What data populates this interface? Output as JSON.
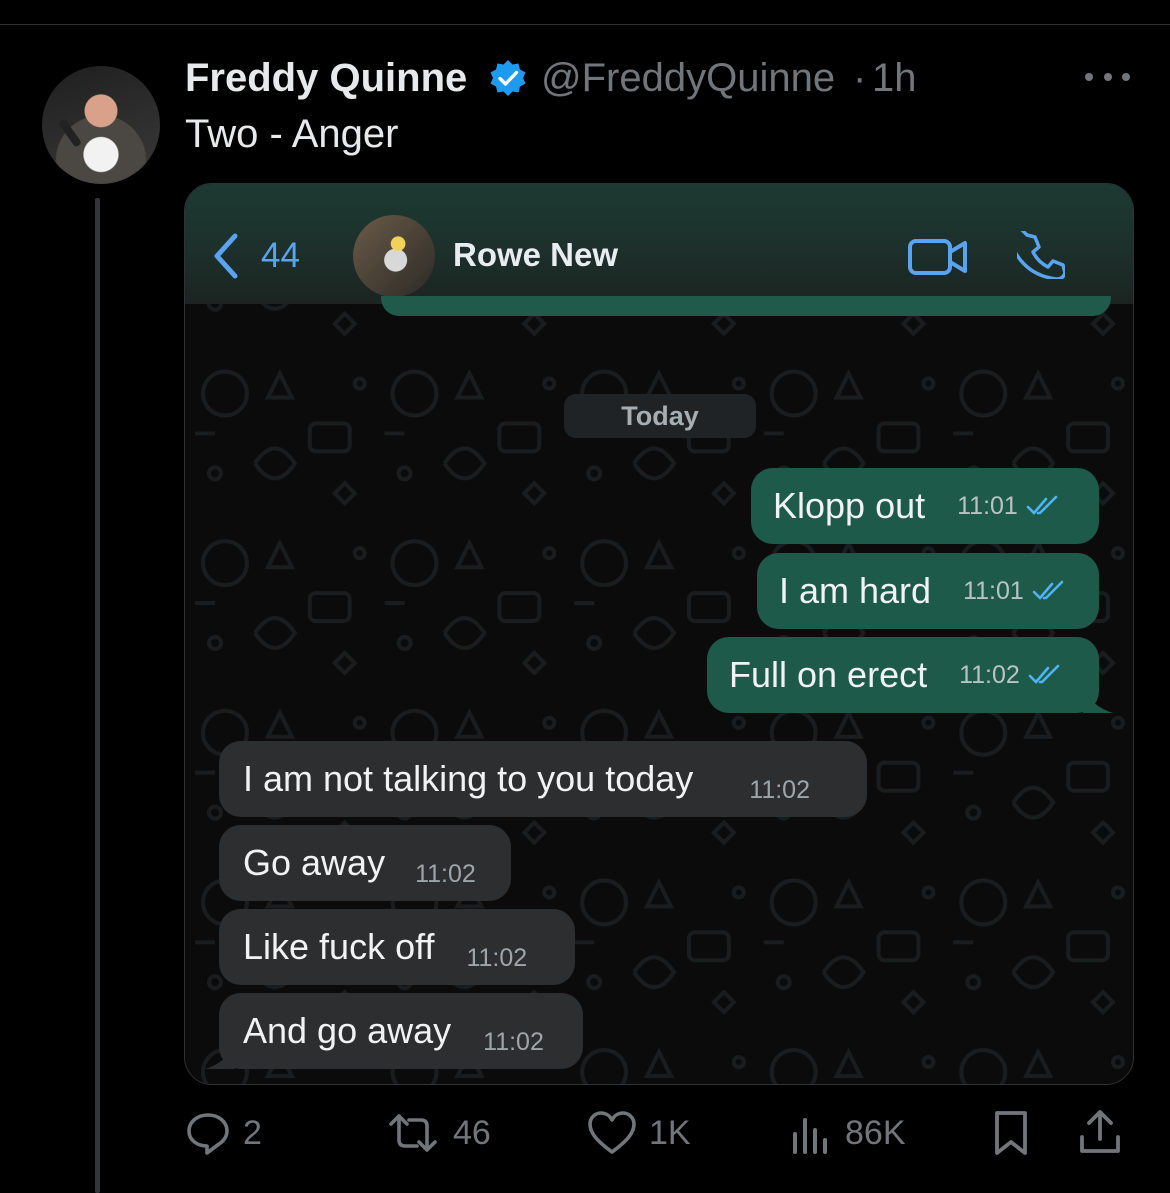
{
  "tweet": {
    "author_name": "Freddy Quinne",
    "handle": "@FreddyQuinne",
    "separator": "·",
    "time": "1h",
    "text": "Two - Anger"
  },
  "chat": {
    "back_count": "44",
    "contact_name": "Rowe New",
    "date_label": "Today",
    "messages": [
      {
        "dir": "out",
        "text": "Klopp out",
        "time": "11:01"
      },
      {
        "dir": "out",
        "text": "I am hard",
        "time": "11:01"
      },
      {
        "dir": "out",
        "text": "Full on erect",
        "time": "11:02"
      },
      {
        "dir": "in",
        "text": "I am not talking to you today",
        "time": "11:02"
      },
      {
        "dir": "in",
        "text": "Go away",
        "time": "11:02"
      },
      {
        "dir": "in",
        "text": "Like fuck off",
        "time": "11:02"
      },
      {
        "dir": "in",
        "text": "And go away",
        "time": "11:02"
      }
    ]
  },
  "actions": {
    "replies": "2",
    "reposts": "46",
    "likes": "1K",
    "views": "86K"
  },
  "icons": {
    "verified": "verified-badge-icon",
    "more": "more-icon",
    "back": "chevron-left-icon",
    "video": "video-call-icon",
    "phone": "phone-icon",
    "read": "double-check-icon",
    "reply": "reply-icon",
    "repost": "repost-icon",
    "like": "heart-icon",
    "views": "views-icon",
    "bookmark": "bookmark-icon",
    "share": "share-icon"
  },
  "colors": {
    "background": "#000000",
    "text": "#e7e9ea",
    "muted": "#71767b",
    "verified": "#1d9bf0",
    "whatsapp_out": "#1e5a49",
    "whatsapp_in": "#2d2e30",
    "link_blue": "#5aa3f0"
  }
}
